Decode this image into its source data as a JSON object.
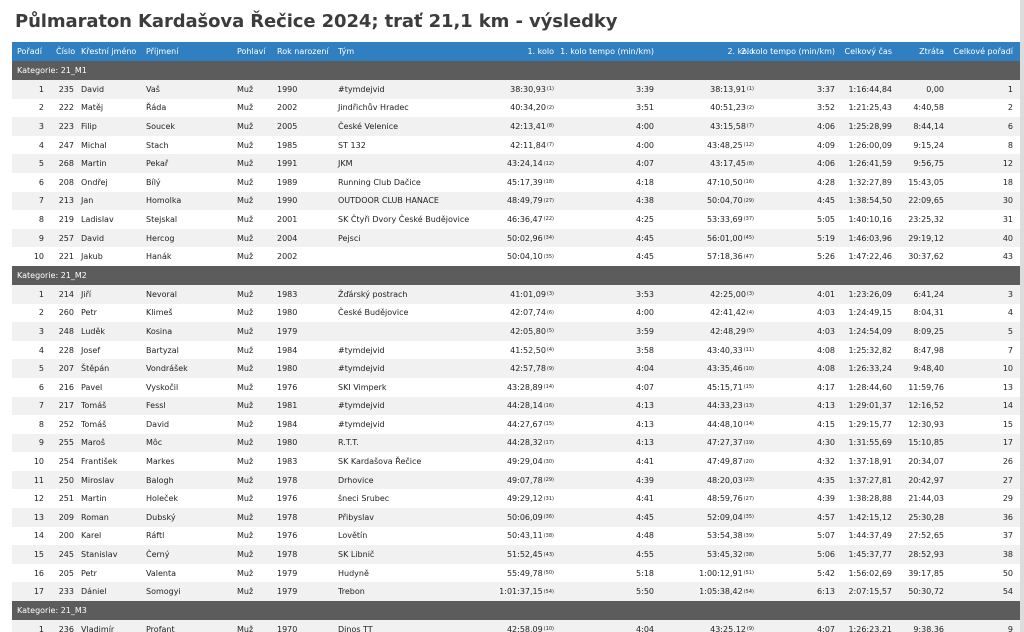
{
  "title": "Půlmaraton Kardašova Řečice 2024; trať 21,1 km - výsledky",
  "columns": [
    "Pořadí",
    "Číslo",
    "Křestní jméno",
    "Příjmení",
    "Pohlaví",
    "Rok narození",
    "Tým",
    "1. kolo",
    "1. kolo tempo (min/km)",
    "2. kolo",
    "2. kolo tempo (min/km)",
    "Celkový čas",
    "Ztráta",
    "Celkové pořadí"
  ],
  "categories": [
    {
      "label": "Kategorie: 21_M1",
      "rows": [
        {
          "rank": "1",
          "num": "235",
          "first": "David",
          "last": "Vaš",
          "sex": "Muž",
          "year": "1990",
          "team": "#tymdejvid",
          "lap1": "38:30,93",
          "lap1_sup": "(1)",
          "pace1": "3:39",
          "lap2": "38:13,91",
          "lap2_sup": "(1)",
          "pace2": "3:37",
          "total": "1:16:44,84",
          "loss": "0,00",
          "overall": "1"
        },
        {
          "rank": "2",
          "num": "222",
          "first": "Matěj",
          "last": "Řáda",
          "sex": "Muž",
          "year": "2002",
          "team": "Jindřichův Hradec",
          "lap1": "40:34,20",
          "lap1_sup": "(2)",
          "pace1": "3:51",
          "lap2": "40:51,23",
          "lap2_sup": "(2)",
          "pace2": "3:52",
          "total": "1:21:25,43",
          "loss": "4:40,58",
          "overall": "2"
        },
        {
          "rank": "3",
          "num": "223",
          "first": "Filip",
          "last": "Soucek",
          "sex": "Muž",
          "year": "2005",
          "team": "České Velenice",
          "lap1": "42:13,41",
          "lap1_sup": "(8)",
          "pace1": "4:00",
          "lap2": "43:15,58",
          "lap2_sup": "(7)",
          "pace2": "4:06",
          "total": "1:25:28,99",
          "loss": "8:44,14",
          "overall": "6"
        },
        {
          "rank": "4",
          "num": "247",
          "first": "Michal",
          "last": "Stach",
          "sex": "Muž",
          "year": "1985",
          "team": "ST 132",
          "lap1": "42:11,84",
          "lap1_sup": "(7)",
          "pace1": "4:00",
          "lap2": "43:48,25",
          "lap2_sup": "(12)",
          "pace2": "4:09",
          "total": "1:26:00,09",
          "loss": "9:15,24",
          "overall": "8"
        },
        {
          "rank": "5",
          "num": "268",
          "first": "Martin",
          "last": "Pekař",
          "sex": "Muž",
          "year": "1991",
          "team": "JKM",
          "lap1": "43:24,14",
          "lap1_sup": "(12)",
          "pace1": "4:07",
          "lap2": "43:17,45",
          "lap2_sup": "(8)",
          "pace2": "4:06",
          "total": "1:26:41,59",
          "loss": "9:56,75",
          "overall": "12"
        },
        {
          "rank": "6",
          "num": "208",
          "first": "Ondřej",
          "last": "Bílý",
          "sex": "Muž",
          "year": "1989",
          "team": "Running Club Dačice",
          "lap1": "45:17,39",
          "lap1_sup": "(18)",
          "pace1": "4:18",
          "lap2": "47:10,50",
          "lap2_sup": "(16)",
          "pace2": "4:28",
          "total": "1:32:27,89",
          "loss": "15:43,05",
          "overall": "18"
        },
        {
          "rank": "7",
          "num": "213",
          "first": "Jan",
          "last": "Homolka",
          "sex": "Muž",
          "year": "1990",
          "team": "OUTDOOR CLUB HANACE",
          "lap1": "48:49,79",
          "lap1_sup": "(27)",
          "pace1": "4:38",
          "lap2": "50:04,70",
          "lap2_sup": "(29)",
          "pace2": "4:45",
          "total": "1:38:54,50",
          "loss": "22:09,65",
          "overall": "30"
        },
        {
          "rank": "8",
          "num": "219",
          "first": "Ladislav",
          "last": "Stejskal",
          "sex": "Muž",
          "year": "2001",
          "team": "SK Čtyři Dvory České Budějovice",
          "lap1": "46:36,47",
          "lap1_sup": "(22)",
          "pace1": "4:25",
          "lap2": "53:33,69",
          "lap2_sup": "(37)",
          "pace2": "5:05",
          "total": "1:40:10,16",
          "loss": "23:25,32",
          "overall": "31"
        },
        {
          "rank": "9",
          "num": "257",
          "first": "David",
          "last": "Hercog",
          "sex": "Muž",
          "year": "2004",
          "team": "Pejsci",
          "lap1": "50:02,96",
          "lap1_sup": "(34)",
          "pace1": "4:45",
          "lap2": "56:01,00",
          "lap2_sup": "(45)",
          "pace2": "5:19",
          "total": "1:46:03,96",
          "loss": "29:19,12",
          "overall": "40"
        },
        {
          "rank": "10",
          "num": "221",
          "first": "Jakub",
          "last": "Hanák",
          "sex": "Muž",
          "year": "2002",
          "team": "",
          "lap1": "50:04,10",
          "lap1_sup": "(35)",
          "pace1": "4:45",
          "lap2": "57:18,36",
          "lap2_sup": "(47)",
          "pace2": "5:26",
          "total": "1:47:22,46",
          "loss": "30:37,62",
          "overall": "43"
        }
      ]
    },
    {
      "label": "Kategorie: 21_M2",
      "rows": [
        {
          "rank": "1",
          "num": "214",
          "first": "Jiří",
          "last": "Nevoral",
          "sex": "Muž",
          "year": "1983",
          "team": "Žďárský postrach",
          "lap1": "41:01,09",
          "lap1_sup": "(3)",
          "pace1": "3:53",
          "lap2": "42:25,00",
          "lap2_sup": "(3)",
          "pace2": "4:01",
          "total": "1:23:26,09",
          "loss": "6:41,24",
          "overall": "3"
        },
        {
          "rank": "2",
          "num": "260",
          "first": "Petr",
          "last": "Klimeš",
          "sex": "Muž",
          "year": "1980",
          "team": "České Budějovice",
          "lap1": "42:07,74",
          "lap1_sup": "(6)",
          "pace1": "4:00",
          "lap2": "42:41,42",
          "lap2_sup": "(4)",
          "pace2": "4:03",
          "total": "1:24:49,15",
          "loss": "8:04,31",
          "overall": "4"
        },
        {
          "rank": "3",
          "num": "248",
          "first": "Luděk",
          "last": "Kosina",
          "sex": "Muž",
          "year": "1979",
          "team": "",
          "lap1": "42:05,80",
          "lap1_sup": "(5)",
          "pace1": "3:59",
          "lap2": "42:48,29",
          "lap2_sup": "(5)",
          "pace2": "4:03",
          "total": "1:24:54,09",
          "loss": "8:09,25",
          "overall": "5"
        },
        {
          "rank": "4",
          "num": "228",
          "first": "Josef",
          "last": "Bartyzal",
          "sex": "Muž",
          "year": "1984",
          "team": "#tymdejvid",
          "lap1": "41:52,50",
          "lap1_sup": "(4)",
          "pace1": "3:58",
          "lap2": "43:40,33",
          "lap2_sup": "(11)",
          "pace2": "4:08",
          "total": "1:25:32,82",
          "loss": "8:47,98",
          "overall": "7"
        },
        {
          "rank": "5",
          "num": "207",
          "first": "Štěpán",
          "last": "Vondrášek",
          "sex": "Muž",
          "year": "1980",
          "team": "#tymdejvid",
          "lap1": "42:57,78",
          "lap1_sup": "(9)",
          "pace1": "4:04",
          "lap2": "43:35,46",
          "lap2_sup": "(10)",
          "pace2": "4:08",
          "total": "1:26:33,24",
          "loss": "9:48,40",
          "overall": "10"
        },
        {
          "rank": "6",
          "num": "216",
          "first": "Pavel",
          "last": "Vyskočil",
          "sex": "Muž",
          "year": "1976",
          "team": "SKI Vimperk",
          "lap1": "43:28,89",
          "lap1_sup": "(14)",
          "pace1": "4:07",
          "lap2": "45:15,71",
          "lap2_sup": "(15)",
          "pace2": "4:17",
          "total": "1:28:44,60",
          "loss": "11:59,76",
          "overall": "13"
        },
        {
          "rank": "7",
          "num": "217",
          "first": "Tomáš",
          "last": "Fessl",
          "sex": "Muž",
          "year": "1981",
          "team": "#tymdejvid",
          "lap1": "44:28,14",
          "lap1_sup": "(16)",
          "pace1": "4:13",
          "lap2": "44:33,23",
          "lap2_sup": "(13)",
          "pace2": "4:13",
          "total": "1:29:01,37",
          "loss": "12:16,52",
          "overall": "14"
        },
        {
          "rank": "8",
          "num": "252",
          "first": "Tomáš",
          "last": "David",
          "sex": "Muž",
          "year": "1984",
          "team": "#tymdejvid",
          "lap1": "44:27,67",
          "lap1_sup": "(15)",
          "pace1": "4:13",
          "lap2": "44:48,10",
          "lap2_sup": "(14)",
          "pace2": "4:15",
          "total": "1:29:15,77",
          "loss": "12:30,93",
          "overall": "15"
        },
        {
          "rank": "9",
          "num": "255",
          "first": "Maroš",
          "last": "Môc",
          "sex": "Muž",
          "year": "1980",
          "team": "R.T.T.",
          "lap1": "44:28,32",
          "lap1_sup": "(17)",
          "pace1": "4:13",
          "lap2": "47:27,37",
          "lap2_sup": "(19)",
          "pace2": "4:30",
          "total": "1:31:55,69",
          "loss": "15:10,85",
          "overall": "17"
        },
        {
          "rank": "10",
          "num": "254",
          "first": "František",
          "last": "Markes",
          "sex": "Muž",
          "year": "1983",
          "team": "SK Kardašova Řečice",
          "lap1": "49:29,04",
          "lap1_sup": "(30)",
          "pace1": "4:41",
          "lap2": "47:49,87",
          "lap2_sup": "(20)",
          "pace2": "4:32",
          "total": "1:37:18,91",
          "loss": "20:34,07",
          "overall": "26"
        },
        {
          "rank": "11",
          "num": "250",
          "first": "Miroslav",
          "last": "Balogh",
          "sex": "Muž",
          "year": "1978",
          "team": "Drhovice",
          "lap1": "49:07,78",
          "lap1_sup": "(29)",
          "pace1": "4:39",
          "lap2": "48:20,03",
          "lap2_sup": "(23)",
          "pace2": "4:35",
          "total": "1:37:27,81",
          "loss": "20:42,97",
          "overall": "27"
        },
        {
          "rank": "12",
          "num": "251",
          "first": "Martin",
          "last": "Holeček",
          "sex": "Muž",
          "year": "1976",
          "team": "šneci Srubec",
          "lap1": "49:29,12",
          "lap1_sup": "(31)",
          "pace1": "4:41",
          "lap2": "48:59,76",
          "lap2_sup": "(27)",
          "pace2": "4:39",
          "total": "1:38:28,88",
          "loss": "21:44,03",
          "overall": "29"
        },
        {
          "rank": "13",
          "num": "209",
          "first": "Roman",
          "last": "Dubský",
          "sex": "Muž",
          "year": "1978",
          "team": "Přibyslav",
          "lap1": "50:06,09",
          "lap1_sup": "(36)",
          "pace1": "4:45",
          "lap2": "52:09,04",
          "lap2_sup": "(35)",
          "pace2": "4:57",
          "total": "1:42:15,12",
          "loss": "25:30,28",
          "overall": "36"
        },
        {
          "rank": "14",
          "num": "200",
          "first": "Karel",
          "last": "Ráftl",
          "sex": "Muž",
          "year": "1976",
          "team": "Lovětín",
          "lap1": "50:43,11",
          "lap1_sup": "(38)",
          "pace1": "4:48",
          "lap2": "53:54,38",
          "lap2_sup": "(39)",
          "pace2": "5:07",
          "total": "1:44:37,49",
          "loss": "27:52,65",
          "overall": "37"
        },
        {
          "rank": "15",
          "num": "245",
          "first": "Stanislav",
          "last": "Černý",
          "sex": "Muž",
          "year": "1978",
          "team": "SK Libnič",
          "lap1": "51:52,45",
          "lap1_sup": "(43)",
          "pace1": "4:55",
          "lap2": "53:45,32",
          "lap2_sup": "(38)",
          "pace2": "5:06",
          "total": "1:45:37,77",
          "loss": "28:52,93",
          "overall": "38"
        },
        {
          "rank": "16",
          "num": "205",
          "first": "Petr",
          "last": "Valenta",
          "sex": "Muž",
          "year": "1979",
          "team": "Hudyně",
          "lap1": "55:49,78",
          "lap1_sup": "(50)",
          "pace1": "5:18",
          "lap2": "1:00:12,91",
          "lap2_sup": "(51)",
          "pace2": "5:42",
          "total": "1:56:02,69",
          "loss": "39:17,85",
          "overall": "50"
        },
        {
          "rank": "17",
          "num": "233",
          "first": "Dániel",
          "last": "Somogyi",
          "sex": "Muž",
          "year": "1979",
          "team": "Trebon",
          "lap1": "1:01:37,15",
          "lap1_sup": "(54)",
          "pace1": "5:50",
          "lap2": "1:05:38,42",
          "lap2_sup": "(54)",
          "pace2": "6:13",
          "total": "2:07:15,57",
          "loss": "50:30,72",
          "overall": "54"
        }
      ]
    },
    {
      "label": "Kategorie: 21_M3",
      "rows": [
        {
          "rank": "1",
          "num": "236",
          "first": "Vladimír",
          "last": "Profant",
          "sex": "Muž",
          "year": "1970",
          "team": "Dinos TT",
          "lap1": "42:58,09",
          "lap1_sup": "(10)",
          "pace1": "4:04",
          "lap2": "43:25,12",
          "lap2_sup": "(9)",
          "pace2": "4:07",
          "total": "1:26:23,21",
          "loss": "9:38,36",
          "overall": "9"
        }
      ]
    }
  ]
}
